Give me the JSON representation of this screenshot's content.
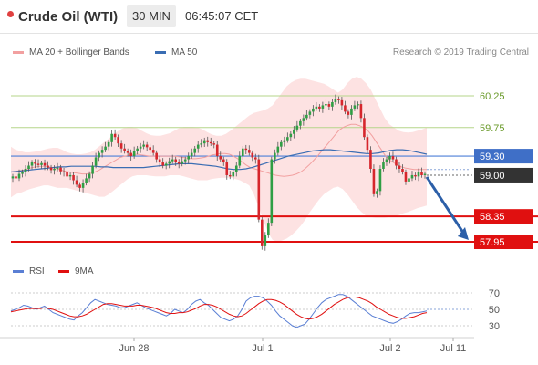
{
  "header": {
    "symbol": "Crude Oil (WTI)",
    "timeframe": "30 MIN",
    "clock": "06:45:07 CET"
  },
  "legend": {
    "ma20_label": "MA 20 + Bollinger Bands",
    "ma50_label": "MA 50",
    "rsi_label": "RSI",
    "ma9_label": "9MA"
  },
  "copyright": "Research © 2019 Trading Central",
  "colors": {
    "candle_up": "#2f9e44",
    "candle_down": "#d6262c",
    "bollinger_fill": "#fde2e2",
    "ma20": "#f2a0a0",
    "ma50": "#3a6db3",
    "resistance": "#b5d58a",
    "support": "#e01010",
    "pivot": "#4c7fd8",
    "rsi": "#5a7fd4",
    "rsi_ma": "#e01010"
  },
  "chart_data": [
    {
      "type": "candlestick",
      "name": "price",
      "x_labels": [
        "Jun 28",
        "Jul 1",
        "Jul 2",
        "Jul 11"
      ],
      "ylim": [
        57.8,
        60.5
      ],
      "levels": [
        {
          "value": 60.25,
          "label": "60.25",
          "kind": "resistance"
        },
        {
          "value": 59.75,
          "label": "59.75",
          "kind": "resistance"
        },
        {
          "value": 59.3,
          "label": "59.30",
          "kind": "pivot"
        },
        {
          "value": 59.0,
          "label": "59.00",
          "kind": "last"
        },
        {
          "value": 58.35,
          "label": "58.35",
          "kind": "support"
        },
        {
          "value": 57.95,
          "label": "57.95",
          "kind": "support"
        }
      ],
      "forecast": {
        "from": 59.0,
        "to": 57.95
      },
      "close": [
        58.98,
        58.95,
        59.02,
        59.05,
        59.1,
        59.15,
        59.2,
        59.18,
        59.16,
        59.19,
        59.15,
        59.12,
        59.08,
        59.1,
        59.12,
        59.06,
        59.05,
        58.98,
        59.0,
        58.92,
        58.85,
        58.8,
        58.88,
        58.95,
        59.02,
        59.15,
        59.28,
        59.35,
        59.4,
        59.45,
        59.52,
        59.65,
        59.6,
        59.5,
        59.42,
        59.38,
        59.35,
        59.3,
        59.38,
        59.42,
        59.45,
        59.48,
        59.44,
        59.4,
        59.35,
        59.25,
        59.2,
        59.15,
        59.18,
        59.22,
        59.25,
        59.2,
        59.18,
        59.22,
        59.25,
        59.3,
        59.35,
        59.42,
        59.48,
        59.5,
        59.55,
        59.52,
        59.5,
        59.48,
        59.3,
        59.25,
        59.2,
        59.0,
        58.98,
        59.05,
        59.15,
        59.3,
        59.42,
        59.4,
        59.35,
        59.28,
        59.25,
        58.3,
        57.88,
        58.05,
        58.25,
        59.25,
        59.35,
        59.45,
        59.52,
        59.55,
        59.6,
        59.65,
        59.72,
        59.78,
        59.85,
        59.9,
        59.95,
        60.0,
        60.05,
        60.08,
        60.05,
        60.1,
        60.12,
        60.08,
        60.15,
        60.2,
        60.18,
        60.1,
        60.0,
        59.95,
        60.05,
        60.1,
        60.12,
        59.9,
        59.6,
        59.4,
        59.1,
        58.7,
        58.75,
        59.1,
        59.2,
        59.25,
        59.3,
        59.25,
        59.15,
        59.1,
        59.05,
        58.9,
        58.95,
        59.0,
        58.98,
        59.05,
        59.0,
        59.02
      ],
      "ma20": [
        59.05,
        59.06,
        59.07,
        59.08,
        59.1,
        59.12,
        59.13,
        59.14,
        59.14,
        59.13,
        59.12,
        59.1,
        59.08,
        59.06,
        59.05,
        59.04,
        59.03,
        59.02,
        59.02,
        59.03,
        59.05,
        59.08,
        59.12,
        59.16,
        59.2,
        59.24,
        59.28,
        59.3,
        59.31,
        59.32,
        59.33,
        59.32,
        59.31,
        59.3,
        59.3,
        59.3,
        59.3,
        59.3,
        59.3,
        59.3,
        59.29,
        59.28,
        59.27,
        59.26,
        59.26,
        59.27,
        59.28,
        59.3,
        59.32,
        59.33,
        59.34,
        59.34,
        59.33,
        59.3,
        59.26,
        59.21,
        59.16,
        59.12,
        59.1,
        59.08,
        59.06,
        59.04,
        59.02,
        59.0,
        58.99,
        58.98,
        58.99,
        59.0,
        59.02,
        59.05,
        59.1,
        59.16,
        59.23,
        59.3,
        59.38,
        59.46,
        59.54,
        59.62,
        59.7,
        59.75,
        59.78,
        59.8,
        59.8,
        59.78,
        59.75,
        59.7,
        59.62,
        59.52,
        59.42,
        59.32,
        59.25,
        59.2,
        59.16,
        59.13,
        59.11,
        59.1,
        59.09,
        59.09,
        59.09,
        59.09
      ],
      "ma50": [
        59.05,
        59.06,
        59.07,
        59.08,
        59.09,
        59.1,
        59.11,
        59.12,
        59.13,
        59.13,
        59.14,
        59.14,
        59.14,
        59.14,
        59.14,
        59.13,
        59.13,
        59.12,
        59.12,
        59.12,
        59.12,
        59.12,
        59.12,
        59.13,
        59.14,
        59.15,
        59.16,
        59.17,
        59.18,
        59.18,
        59.18,
        59.17,
        59.16,
        59.15,
        59.14,
        59.12,
        59.1,
        59.09,
        59.09,
        59.1,
        59.12,
        59.15,
        59.18,
        59.21,
        59.24,
        59.27,
        59.3,
        59.32,
        59.34,
        59.36,
        59.38,
        59.39,
        59.4,
        59.4,
        59.39,
        59.38,
        59.37,
        59.36,
        59.35,
        59.34,
        59.34,
        59.35,
        59.37,
        59.39,
        59.4,
        59.4,
        59.39,
        59.37,
        59.35,
        59.33
      ],
      "bb_upper": [
        59.45,
        59.4,
        59.38,
        59.36,
        59.36,
        59.37,
        59.38,
        59.4,
        59.42,
        59.43,
        59.43,
        59.4,
        59.36,
        59.34,
        59.33,
        59.33,
        59.34,
        59.36,
        59.4,
        59.46,
        59.52,
        59.58,
        59.64,
        59.7,
        59.74,
        59.76,
        59.76,
        59.74,
        59.7,
        59.66,
        59.63,
        59.62,
        59.62,
        59.64,
        59.66,
        59.7,
        59.74,
        59.76,
        59.76,
        59.76,
        59.75,
        59.72,
        59.68,
        59.64,
        59.62,
        59.62,
        59.65,
        59.7,
        59.76,
        59.82,
        59.88,
        59.94,
        59.98,
        60.0,
        60.02,
        60.05,
        60.1,
        60.2,
        60.3,
        60.4,
        60.46,
        60.5,
        60.52,
        60.52,
        60.5,
        60.48,
        60.46,
        60.44,
        60.4,
        60.35,
        60.3,
        60.35,
        60.45,
        60.52,
        60.55,
        60.52,
        60.45,
        60.35,
        60.2,
        60.05,
        59.9,
        59.8,
        59.75,
        59.7,
        59.68,
        59.67,
        59.68,
        59.7,
        59.72,
        59.75
      ],
      "bb_lower": [
        58.65,
        58.7,
        58.72,
        58.75,
        58.78,
        58.8,
        58.82,
        58.84,
        58.84,
        58.82,
        58.8,
        58.8,
        58.8,
        58.78,
        58.76,
        58.74,
        58.72,
        58.7,
        58.68,
        58.66,
        58.66,
        58.7,
        58.76,
        58.82,
        58.88,
        58.94,
        58.98,
        59.0,
        59.0,
        59.0,
        58.99,
        58.98,
        58.98,
        58.98,
        59.0,
        59.0,
        59.0,
        58.98,
        58.96,
        58.94,
        58.92,
        58.92,
        58.92,
        58.94,
        58.95,
        58.96,
        58.96,
        58.96,
        58.94,
        58.92,
        58.88,
        58.84,
        58.7,
        58.5,
        58.3,
        58.1,
        57.98,
        57.95,
        57.97,
        58.0,
        58.05,
        58.12,
        58.2,
        58.3,
        58.42,
        58.52,
        58.62,
        58.7,
        58.75,
        58.8,
        58.82,
        58.78,
        58.7,
        58.6,
        58.5,
        58.42,
        58.36,
        58.34,
        58.33,
        58.33,
        58.33,
        58.34,
        58.35,
        58.37,
        58.4,
        58.42,
        58.45,
        58.48,
        58.5,
        58.52
      ]
    },
    {
      "type": "line",
      "name": "rsi",
      "y_ticks": [
        70,
        50,
        30
      ],
      "ylim": [
        20,
        80
      ],
      "series": [
        {
          "name": "RSI",
          "values": [
            48,
            50,
            52,
            55,
            54,
            52,
            50,
            52,
            54,
            50,
            46,
            44,
            42,
            40,
            38,
            37,
            42,
            46,
            52,
            58,
            62,
            60,
            58,
            56,
            55,
            54,
            52,
            52,
            54,
            56,
            58,
            55,
            52,
            50,
            48,
            46,
            44,
            42,
            45,
            50,
            48,
            46,
            50,
            56,
            60,
            62,
            58,
            55,
            50,
            45,
            40,
            38,
            36,
            38,
            42,
            50,
            60,
            64,
            66,
            66,
            64,
            60,
            55,
            48,
            42,
            38,
            34,
            30,
            28,
            30,
            32,
            38,
            45,
            52,
            58,
            62,
            64,
            66,
            68,
            68,
            66,
            62,
            58,
            54,
            50,
            46,
            42,
            40,
            38,
            36,
            34,
            33,
            35,
            38,
            42,
            45,
            46,
            46,
            47,
            48
          ]
        },
        {
          "name": "9MA",
          "values": [
            47,
            48,
            49,
            50,
            51,
            51,
            51,
            51,
            52,
            51,
            50,
            48,
            46,
            44,
            42,
            41,
            41,
            42,
            44,
            47,
            50,
            53,
            56,
            57,
            57,
            56,
            55,
            54,
            54,
            54,
            55,
            55,
            54,
            53,
            52,
            50,
            48,
            46,
            45,
            45,
            46,
            46,
            47,
            49,
            51,
            54,
            56,
            56,
            55,
            53,
            50,
            47,
            44,
            42,
            41,
            42,
            45,
            49,
            53,
            57,
            60,
            62,
            62,
            61,
            59,
            56,
            52,
            48,
            44,
            41,
            39,
            38,
            39,
            41,
            44,
            48,
            52,
            56,
            59,
            62,
            64,
            65,
            65,
            64,
            62,
            60,
            57,
            53,
            50,
            47,
            44,
            42,
            40,
            39,
            39,
            40,
            41,
            43,
            45,
            46
          ]
        }
      ]
    }
  ]
}
